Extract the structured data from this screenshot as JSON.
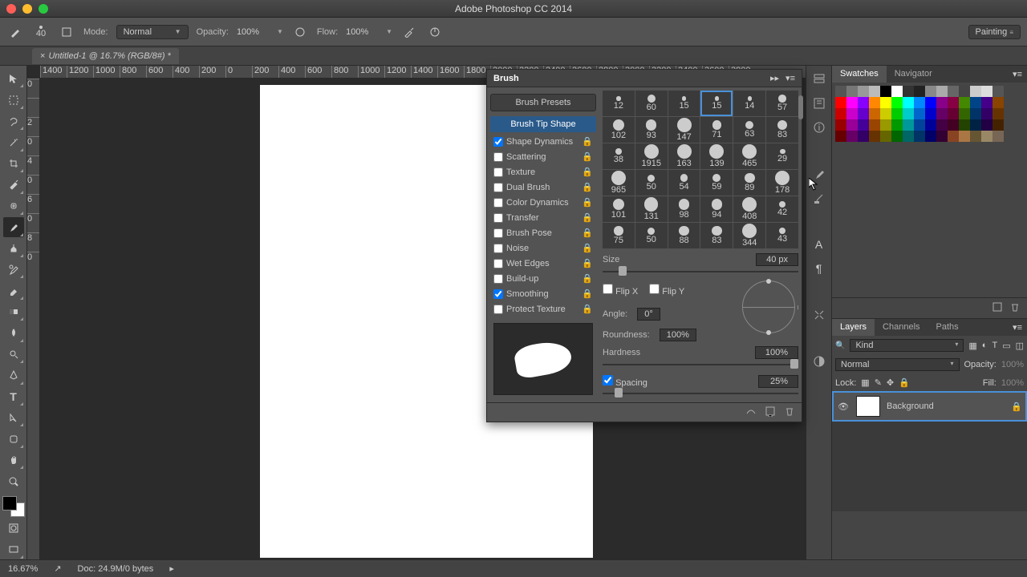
{
  "app": {
    "title": "Adobe Photoshop CC 2014"
  },
  "document": {
    "tab_label": "Untitled-1 @ 16.7% (RGB/8#) *"
  },
  "options": {
    "brush_size_num": "40",
    "mode_label": "Mode:",
    "mode_value": "Normal",
    "opacity_label": "Opacity:",
    "opacity_value": "100%",
    "flow_label": "Flow:",
    "flow_value": "100%",
    "workspace": "Painting"
  },
  "ruler_h": [
    "1400",
    "1200",
    "1000",
    "800",
    "600",
    "400",
    "200",
    "0",
    "200",
    "400",
    "600",
    "800",
    "1000",
    "1200",
    "1400",
    "1600",
    "1800",
    "2000",
    "2200",
    "2400",
    "2600",
    "2800",
    "3000",
    "3200",
    "3400",
    "3600",
    "3800"
  ],
  "ruler_v": [
    "0",
    "",
    "2",
    "0",
    "4",
    "0",
    "6",
    "0",
    "8",
    "0"
  ],
  "brush_panel": {
    "title": "Brush",
    "presets_btn": "Brush Presets",
    "tip_shape": "Brush Tip Shape",
    "options": [
      {
        "label": "Shape Dynamics",
        "checked": true
      },
      {
        "label": "Scattering",
        "checked": false
      },
      {
        "label": "Texture",
        "checked": false
      },
      {
        "label": "Dual Brush",
        "checked": false
      },
      {
        "label": "Color Dynamics",
        "checked": false
      },
      {
        "label": "Transfer",
        "checked": false
      },
      {
        "label": "Brush Pose",
        "checked": false
      },
      {
        "label": "Noise",
        "checked": false
      },
      {
        "label": "Wet Edges",
        "checked": false
      },
      {
        "label": "Build-up",
        "checked": false
      },
      {
        "label": "Smoothing",
        "checked": true
      },
      {
        "label": "Protect Texture",
        "checked": false
      }
    ],
    "size_label": "Size",
    "size_value": "40 px",
    "flipx_label": "Flip X",
    "flipy_label": "Flip Y",
    "angle_label": "Angle:",
    "angle_value": "0°",
    "roundness_label": "Roundness:",
    "roundness_value": "100%",
    "hardness_label": "Hardness",
    "hardness_value": "100%",
    "spacing_label": "Spacing",
    "spacing_value": "25%",
    "tips": [
      "12",
      "60",
      "15",
      "15",
      "14",
      "57",
      "102",
      "93",
      "147",
      "71",
      "63",
      "83",
      "38",
      "1915",
      "163",
      "139",
      "465",
      "29",
      "965",
      "50",
      "54",
      "59",
      "89",
      "178",
      "101",
      "131",
      "98",
      "94",
      "408",
      "42",
      "75",
      "50",
      "88",
      "83",
      "344",
      "43"
    ]
  },
  "swatches": {
    "tab1": "Swatches",
    "tab2": "Navigator",
    "colors": [
      "#555",
      "#777",
      "#999",
      "#bbb",
      "#000",
      "#fff",
      "#333",
      "#222",
      "#888",
      "#aaa",
      "#666",
      "#444",
      "#ccc",
      "#ddd",
      "#555",
      "#f00",
      "#f0f",
      "#80f",
      "#f80",
      "#ff0",
      "#0f0",
      "#0ff",
      "#08f",
      "#00f",
      "#808",
      "#804",
      "#480",
      "#048",
      "#408",
      "#840",
      "#c00",
      "#c0c",
      "#60c",
      "#c60",
      "#cc0",
      "#0c0",
      "#0cc",
      "#06c",
      "#00c",
      "#606",
      "#603",
      "#360",
      "#036",
      "#306",
      "#630",
      "#900",
      "#909",
      "#409",
      "#940",
      "#990",
      "#090",
      "#099",
      "#049",
      "#009",
      "#404",
      "#402",
      "#240",
      "#024",
      "#204",
      "#420",
      "#600",
      "#606",
      "#306",
      "#630",
      "#660",
      "#060",
      "#066",
      "#036",
      "#006",
      "#303",
      "#884422",
      "#aa7744",
      "#665533",
      "#998866",
      "#776655"
    ]
  },
  "layers": {
    "tab1": "Layers",
    "tab2": "Channels",
    "tab3": "Paths",
    "kind_label": "Kind",
    "blend_mode": "Normal",
    "opacity_label": "Opacity:",
    "opacity_value": "100%",
    "lock_label": "Lock:",
    "fill_label": "Fill:",
    "fill_value": "100%",
    "layer0": "Background"
  },
  "status": {
    "zoom": "16.67%",
    "doc": "Doc: 24.9M/0 bytes"
  }
}
